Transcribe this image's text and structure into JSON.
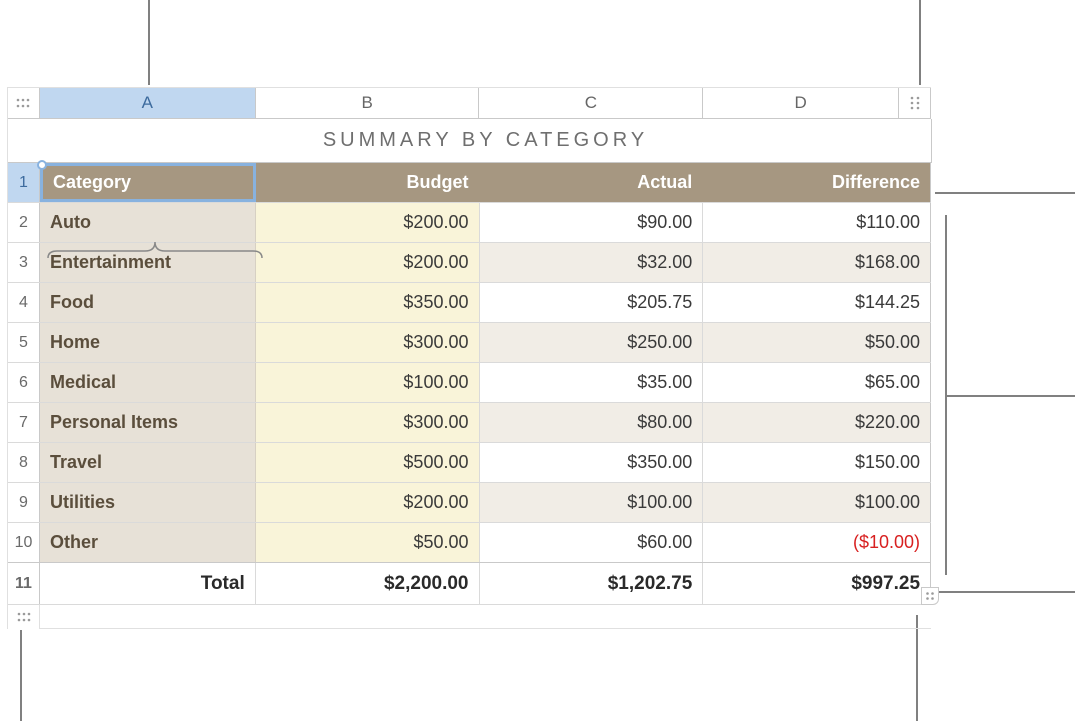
{
  "title": "SUMMARY BY CATEGORY",
  "columns": {
    "A": "A",
    "B": "B",
    "C": "C",
    "D": "D"
  },
  "header": {
    "category": "Category",
    "budget": "Budget",
    "actual": "Actual",
    "difference": "Difference"
  },
  "rows": [
    {
      "n": "2",
      "cat": "Auto",
      "budget": "$200.00",
      "actual": "$90.00",
      "diff": "$110.00"
    },
    {
      "n": "3",
      "cat": "Entertainment",
      "budget": "$200.00",
      "actual": "$32.00",
      "diff": "$168.00"
    },
    {
      "n": "4",
      "cat": "Food",
      "budget": "$350.00",
      "actual": "$205.75",
      "diff": "$144.25"
    },
    {
      "n": "5",
      "cat": "Home",
      "budget": "$300.00",
      "actual": "$250.00",
      "diff": "$50.00"
    },
    {
      "n": "6",
      "cat": "Medical",
      "budget": "$100.00",
      "actual": "$35.00",
      "diff": "$65.00"
    },
    {
      "n": "7",
      "cat": "Personal Items",
      "budget": "$300.00",
      "actual": "$80.00",
      "diff": "$220.00"
    },
    {
      "n": "8",
      "cat": "Travel",
      "budget": "$500.00",
      "actual": "$350.00",
      "diff": "$150.00"
    },
    {
      "n": "9",
      "cat": "Utilities",
      "budget": "$200.00",
      "actual": "$100.00",
      "diff": "$100.00"
    },
    {
      "n": "10",
      "cat": "Other",
      "budget": "$50.00",
      "actual": "$60.00",
      "diff": "($10.00)",
      "neg": true
    }
  ],
  "total": {
    "n": "11",
    "label": "Total",
    "budget": "$2,200.00",
    "actual": "$1,202.75",
    "diff": "$997.25"
  },
  "row_header_n": "1"
}
